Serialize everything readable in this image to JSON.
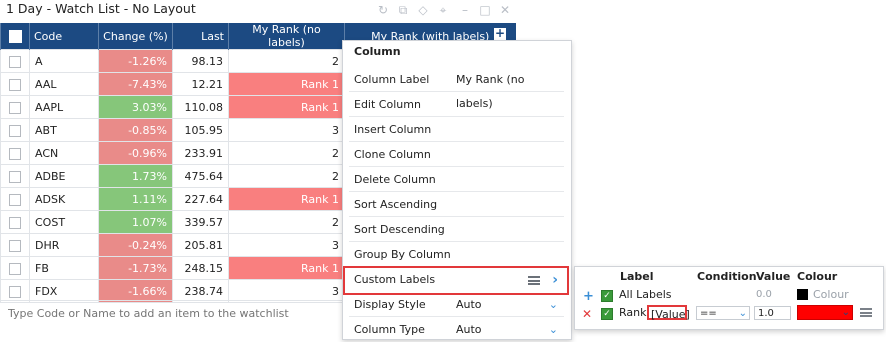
{
  "window": {
    "title": "1 Day - Watch List - No Layout"
  },
  "toolbar_icons": [
    "refresh-icon",
    "copy-icon",
    "diamond-icon",
    "pin-icon",
    "minimize-icon",
    "close-icon"
  ],
  "columns": {
    "code": "Code",
    "change": "Change (%)",
    "last": "Last",
    "rank_no_labels": "My Rank (no labels)",
    "rank_with_labels": "My Rank (with labels)"
  },
  "rows": [
    {
      "code": "A",
      "change": "-1.26%",
      "last": "98.13",
      "rank": "2",
      "dir": "neg",
      "labelled": false
    },
    {
      "code": "AAL",
      "change": "-7.43%",
      "last": "12.21",
      "rank": "Rank 1",
      "dir": "neg",
      "labelled": true
    },
    {
      "code": "AAPL",
      "change": "3.03%",
      "last": "110.08",
      "rank": "Rank 1",
      "dir": "pos",
      "labelled": true
    },
    {
      "code": "ABT",
      "change": "-0.85%",
      "last": "105.95",
      "rank": "3",
      "dir": "neg",
      "labelled": false
    },
    {
      "code": "ACN",
      "change": "-0.96%",
      "last": "233.91",
      "rank": "2",
      "dir": "neg",
      "labelled": false
    },
    {
      "code": "ADBE",
      "change": "1.73%",
      "last": "475.64",
      "rank": "2",
      "dir": "pos",
      "labelled": false
    },
    {
      "code": "ADSK",
      "change": "1.11%",
      "last": "227.64",
      "rank": "Rank 1",
      "dir": "pos",
      "labelled": true
    },
    {
      "code": "COST",
      "change": "1.07%",
      "last": "339.57",
      "rank": "2",
      "dir": "pos",
      "labelled": false
    },
    {
      "code": "DHR",
      "change": "-0.24%",
      "last": "205.81",
      "rank": "3",
      "dir": "neg",
      "labelled": false
    },
    {
      "code": "FB",
      "change": "-1.73%",
      "last": "248.15",
      "rank": "Rank 1",
      "dir": "neg",
      "labelled": true
    },
    {
      "code": "FDX",
      "change": "-1.66%",
      "last": "238.74",
      "rank": "3",
      "dir": "neg",
      "labelled": false
    }
  ],
  "add_placeholder": "Type Code or Name to add an item to the watchlist",
  "menu": {
    "header": "Column",
    "column_label": "Column Label",
    "column_label_value": "My Rank (no labels)",
    "items": [
      "Edit Column",
      "Insert Column",
      "Clone Column",
      "Delete Column",
      "Sort Ascending",
      "Sort Descending",
      "Group By Column"
    ],
    "custom_labels": "Custom Labels",
    "display_style": "Display Style",
    "display_style_value": "Auto",
    "column_type": "Column Type",
    "column_type_value": "Auto"
  },
  "labels_panel": {
    "headers": {
      "label": "Label",
      "condition": "Condition",
      "value": "Value",
      "colour": "Colour"
    },
    "all_labels": {
      "label": "All Labels",
      "value": "0.0",
      "colour_text": "Colour"
    },
    "rule": {
      "label": "Rank",
      "token": "[Value]",
      "condition": "==",
      "value": "1.0",
      "colour": "#ff0000"
    }
  },
  "colors": {
    "header_bg": "#1c4a82",
    "negative": "#e98b89",
    "positive": "#86c67a",
    "rank_highlight": "#f97f7f",
    "accent_blue": "#3b8fd6",
    "highlight_border": "#e2383a"
  }
}
